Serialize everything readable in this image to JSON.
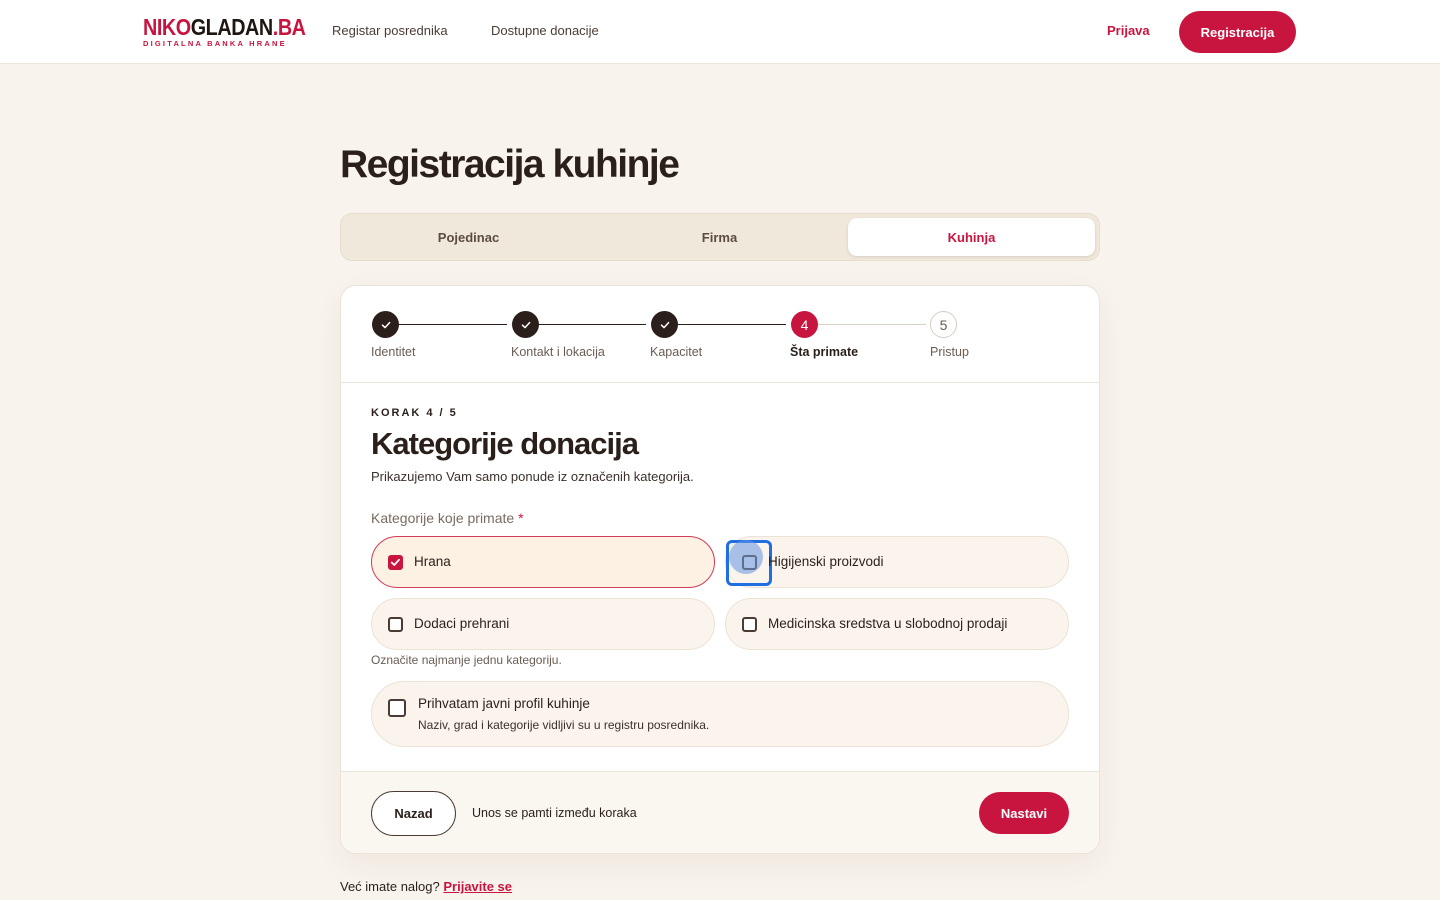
{
  "header": {
    "logo_main_red": "NIKO",
    "logo_main_dark": "GLADAN",
    "logo_main_red2": ".BA",
    "logo_sub": "DIGITALNA BANKA HRANE",
    "nav": [
      {
        "label": "Registar posrednika"
      },
      {
        "label": "Dostupne donacije"
      }
    ],
    "login_label": "Prijava",
    "register_label": "Registracija"
  },
  "page": {
    "title": "Registracija kuhinje",
    "tabs": [
      {
        "label": "Pojedinac",
        "active": false
      },
      {
        "label": "Firma",
        "active": false
      },
      {
        "label": "Kuhinja",
        "active": true
      }
    ]
  },
  "stepper": {
    "steps": [
      {
        "number": "1",
        "label": "Identitet",
        "state": "done"
      },
      {
        "number": "2",
        "label": "Kontakt i lokacija",
        "state": "done"
      },
      {
        "number": "3",
        "label": "Kapacitet",
        "state": "done"
      },
      {
        "number": "4",
        "label": "Šta primate",
        "state": "current"
      },
      {
        "number": "5",
        "label": "Pristup",
        "state": "todo"
      }
    ]
  },
  "form": {
    "kicker": "KORAK 4 / 5",
    "title": "Kategorije donacija",
    "subtitle": "Prikazujemo Vam samo ponude iz označenih kategorija.",
    "field_label": "Kategorije koje primate",
    "required_mark": "*",
    "options": [
      {
        "label": "Hrana",
        "checked": true
      },
      {
        "label": "Higijenski proizvodi",
        "checked": false,
        "focused": true
      },
      {
        "label": "Dodaci prehrani",
        "checked": false
      },
      {
        "label": "Medicinska sredstva u slobodnoj prodaji",
        "checked": false
      }
    ],
    "hint": "Označite najmanje jednu kategoriju.",
    "consent": {
      "title": "Prihvatam javni profil kuhinje",
      "description": "Naziv, grad i kategorije vidljivi su u registru posrednika.",
      "checked": false
    }
  },
  "footer": {
    "back_label": "Nazad",
    "note": "Unos se pamti između koraka",
    "next_label": "Nastavi"
  },
  "bottom": {
    "text": "Već imate nalog?",
    "link": "Prijavite se"
  },
  "colors": {
    "accent": "#c8153f",
    "background": "#f8f3ec",
    "dark": "#2a1f1a",
    "focus": "#1f6fe0"
  },
  "icons": [
    "check-icon",
    "checkbox-icon"
  ]
}
